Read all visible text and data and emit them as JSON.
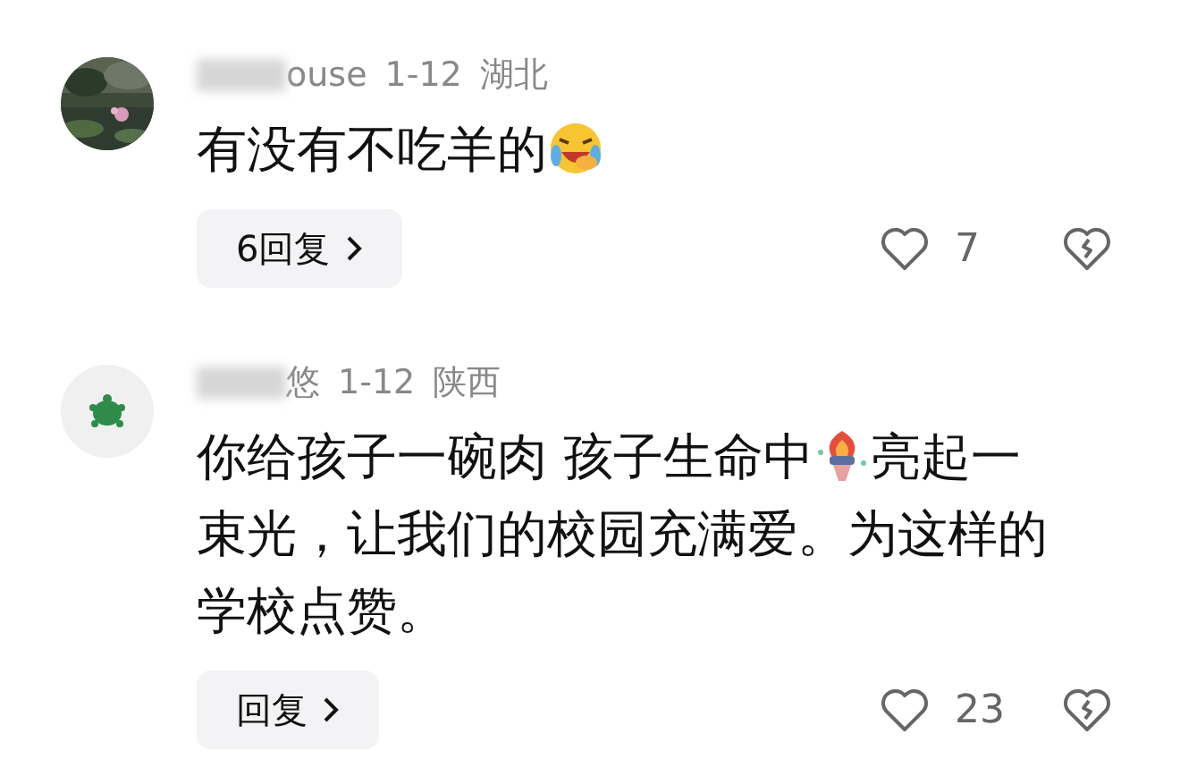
{
  "comments": [
    {
      "avatar": {
        "kind": "picture"
      },
      "username": "ouse",
      "date": "1-12",
      "location": "湖北",
      "body": [
        [
          {
            "kind": "text",
            "text": "有没有不吃羊的"
          },
          {
            "kind": "laugh"
          }
        ]
      ],
      "reply_button": "6回复",
      "likes": "7"
    },
    {
      "avatar": {
        "kind": "turtle"
      },
      "username": "悠",
      "date": "1-12",
      "location": "陕西",
      "body": [
        [
          {
            "kind": "text",
            "text": "你给孩子一碗肉 孩子生命中"
          },
          {
            "kind": "torch"
          },
          {
            "kind": "text",
            "text": "亮起一"
          }
        ],
        [
          {
            "kind": "text",
            "text": "束光，让我们的校园充满爱。为这样的"
          }
        ],
        [
          {
            "kind": "text",
            "text": "学校点赞。"
          }
        ]
      ],
      "reply_button": "回复",
      "likes": "23"
    }
  ]
}
